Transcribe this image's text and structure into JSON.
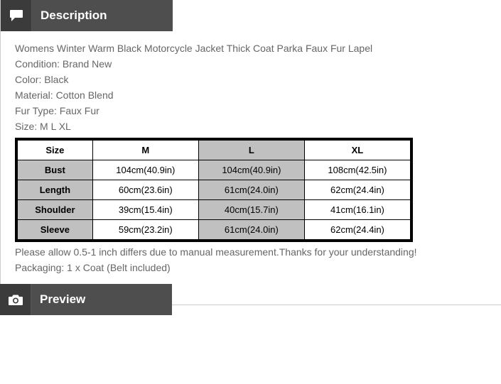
{
  "sections": {
    "description_title": "Description",
    "preview_title": "Preview"
  },
  "description": {
    "title_line": "Womens Winter Warm Black Motorcycle Jacket Thick Coat Parka Faux Fur Lapel",
    "condition": "Condition: Brand New",
    "color": "Color: Black",
    "material": "Material: Cotton Blend",
    "fur_type": "Fur Type: Faux Fur",
    "size_line": "Size: M L XL",
    "note_measure": "Please allow 0.5-1 inch differs due to manual measurement.Thanks for your understanding!",
    "packaging": "Packaging: 1 x Coat (Belt included)"
  },
  "size_table": {
    "headers": {
      "c0": "Size",
      "c1": "M",
      "c2": "L",
      "c3": "XL"
    },
    "rows": [
      {
        "label": "Bust",
        "m": "104cm(40.9in)",
        "l": "104cm(40.9in)",
        "xl": "108cm(42.5in)"
      },
      {
        "label": "Length",
        "m": "60cm(23.6in)",
        "l": "61cm(24.0in)",
        "xl": "62cm(24.4in)"
      },
      {
        "label": "Shoulder",
        "m": "39cm(15.4in)",
        "l": "40cm(15.7in)",
        "xl": "41cm(16.1in)"
      },
      {
        "label": "Sleeve",
        "m": "59cm(23.2in)",
        "l": "61cm(24.0in)",
        "xl": "62cm(24.4in)"
      }
    ]
  },
  "icons": {
    "description": "speech-bubble-icon",
    "preview": "camera-icon"
  }
}
